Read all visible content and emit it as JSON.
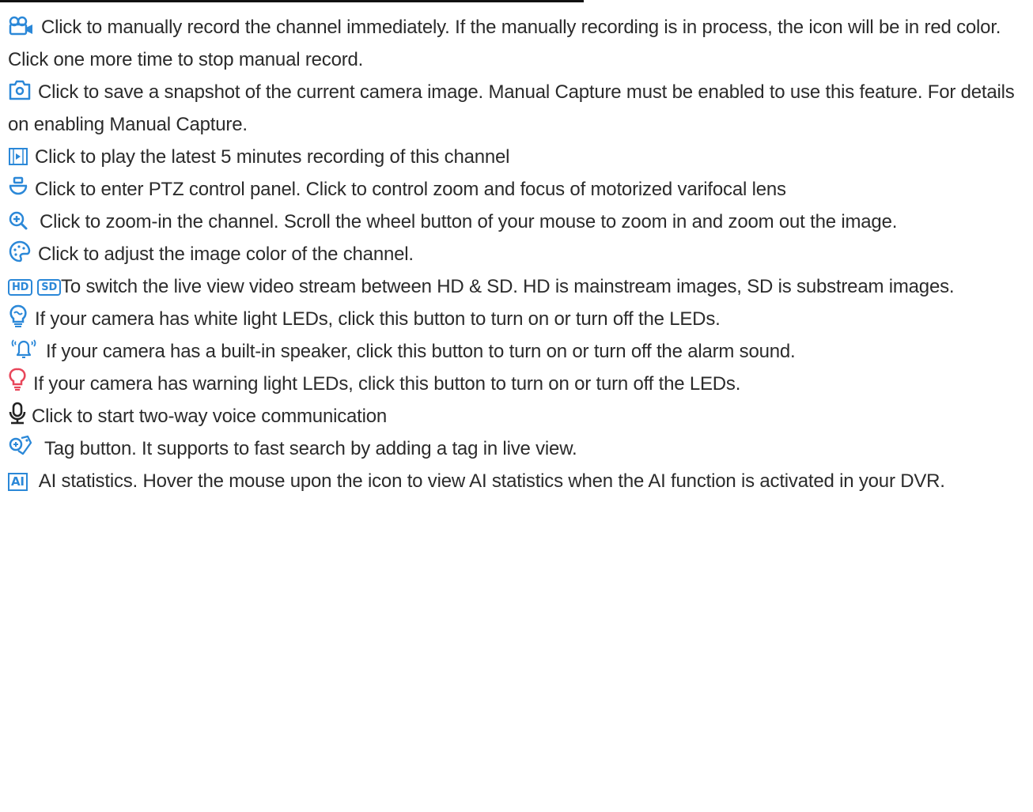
{
  "entries": [
    {
      "icon": "record-icon",
      "text": "Click to manually record the channel immediately. If the manually recording is in process, the icon will be in red color. Click one more time to stop manual record."
    },
    {
      "icon": "snapshot-icon",
      "text": "Click to save a snapshot of the current camera image. Manual Capture must be enabled to use this feature. For details on enabling Manual Capture."
    },
    {
      "icon": "playback-icon",
      "text": "Click to play the latest 5 minutes recording of this channel"
    },
    {
      "icon": "ptz-icon",
      "text": "Click to enter PTZ control panel. Click to control zoom and focus of motorized varifocal lens"
    },
    {
      "icon": "zoom-in-icon",
      "text": "Click to zoom-in the channel. Scroll the wheel button of your mouse to zoom in and zoom out the image."
    },
    {
      "icon": "color-palette-icon",
      "text": "Click to adjust the image color of the channel."
    },
    {
      "icon": "hd-sd-icon",
      "hd_label": "HD",
      "sd_label": "SD",
      "text": "To switch the live view video stream between HD & SD. HD is mainstream images, SD is substream images."
    },
    {
      "icon": "white-light-icon",
      "text": "If your camera has white light LEDs, click this button to turn on or turn off the LEDs."
    },
    {
      "icon": "alarm-bell-icon",
      "text": "If your camera has a built-in speaker, click this button to turn on or turn off the alarm sound."
    },
    {
      "icon": "warning-light-icon",
      "text": "If your camera has warning light LEDs, click this button to turn on or turn off the LEDs."
    },
    {
      "icon": "microphone-icon",
      "text": "Click to start two-way voice communication"
    },
    {
      "icon": "tag-icon",
      "text": "Tag button. It supports to fast search by adding a tag in live view."
    },
    {
      "icon": "ai-statistics-icon",
      "ai_label": "AI",
      "text": "AI statistics. Hover the mouse upon the icon to view AI statistics when the AI function is activated in your DVR."
    }
  ],
  "colors": {
    "accent": "#2b88d8",
    "warning": "#e8465a",
    "text": "#2b2b2b"
  }
}
